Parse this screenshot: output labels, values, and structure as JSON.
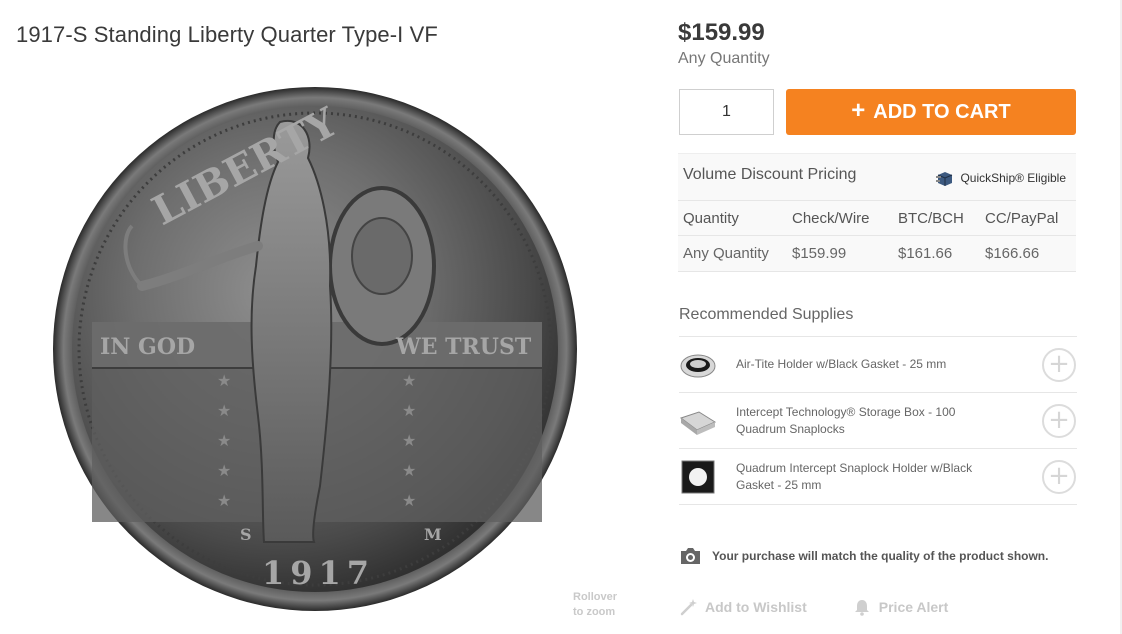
{
  "product": {
    "title": "1917-S Standing Liberty Quarter Type-I VF",
    "price": "$159.99",
    "price_sub": "Any Quantity"
  },
  "purchase": {
    "quantity": "1",
    "add_to_cart_icon": "+",
    "add_to_cart_label": "ADD TO CART",
    "accent_color": "#f58220"
  },
  "image": {
    "rollover_line1": "Rollover",
    "rollover_line2": "to zoom",
    "coin_legend_top": "LIBERTY",
    "coin_motto_left": "IN GOD",
    "coin_motto_right": "WE TRUST",
    "coin_date": "1917",
    "coin_mint_left": "S",
    "coin_mint_right": "M"
  },
  "volume": {
    "title": "Volume Discount Pricing",
    "quickship": "QuickShip® Eligible",
    "headers": [
      "Quantity",
      "Check/Wire",
      "BTC/BCH",
      "CC/PayPal"
    ],
    "rows": [
      [
        "Any Quantity",
        "$159.99",
        "$161.66",
        "$166.66"
      ]
    ]
  },
  "supplies": {
    "title": "Recommended Supplies",
    "items": [
      {
        "label": "Air-Tite Holder w/Black Gasket - 25 mm",
        "icon": "coin-holder-icon"
      },
      {
        "label": "Intercept Technology® Storage Box - 100 Quadrum Snaplocks",
        "icon": "storage-box-icon"
      },
      {
        "label": "Quadrum Intercept Snaplock Holder w/Black Gasket - 25 mm",
        "icon": "snaplock-holder-icon"
      }
    ],
    "add_symbol": "+"
  },
  "notice": {
    "quality": "Your purchase will match the quality of the product shown."
  },
  "actions": {
    "wishlist": "Add to Wishlist",
    "price_alert": "Price Alert"
  }
}
